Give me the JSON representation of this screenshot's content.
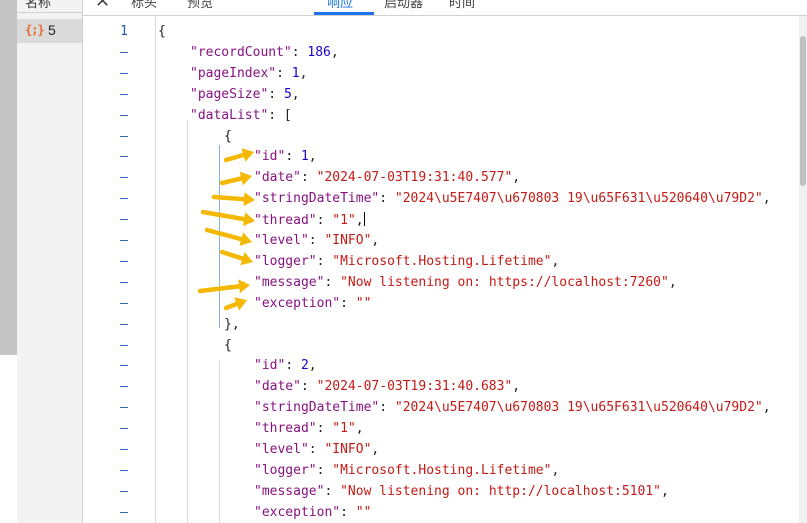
{
  "name_column": {
    "header": "名称",
    "request": {
      "icon": "{;}",
      "name": "5"
    }
  },
  "tabs": [
    {
      "label": "标头"
    },
    {
      "label": "预览"
    },
    {
      "label": "响应",
      "active": true
    },
    {
      "label": "启动器"
    },
    {
      "label": "时间"
    }
  ],
  "gutter": [
    "1",
    "–",
    "–",
    "–",
    "–",
    "–",
    "–",
    "–",
    "–",
    "–",
    "–",
    "–",
    "–",
    "–",
    "–",
    "–",
    "–",
    "–",
    "–",
    "–",
    "–",
    "–",
    "–",
    "–",
    "–"
  ],
  "lines": [
    {
      "indent": 0,
      "tokens": [
        [
          "pun",
          "{"
        ]
      ]
    },
    {
      "indent": 1,
      "tokens": [
        [
          "key",
          "\"recordCount\""
        ],
        [
          "pun",
          ": "
        ],
        [
          "num",
          "186"
        ],
        [
          "pun",
          ","
        ]
      ]
    },
    {
      "indent": 1,
      "tokens": [
        [
          "key",
          "\"pageIndex\""
        ],
        [
          "pun",
          ": "
        ],
        [
          "num",
          "1"
        ],
        [
          "pun",
          ","
        ]
      ]
    },
    {
      "indent": 1,
      "tokens": [
        [
          "key",
          "\"pageSize\""
        ],
        [
          "pun",
          ": "
        ],
        [
          "num",
          "5"
        ],
        [
          "pun",
          ","
        ]
      ]
    },
    {
      "indent": 1,
      "tokens": [
        [
          "key",
          "\"dataList\""
        ],
        [
          "pun",
          ": ["
        ]
      ]
    },
    {
      "indent": 2,
      "tokens": [
        [
          "pun",
          "{"
        ]
      ]
    },
    {
      "indent": 3,
      "tokens": [
        [
          "key",
          "\"id\""
        ],
        [
          "pun",
          ": "
        ],
        [
          "num",
          "1"
        ],
        [
          "pun",
          ","
        ]
      ]
    },
    {
      "indent": 3,
      "tokens": [
        [
          "key",
          "\"date\""
        ],
        [
          "pun",
          ": "
        ],
        [
          "str",
          "\"2024-07-03T19:31:40.577\""
        ],
        [
          "pun",
          ","
        ]
      ]
    },
    {
      "indent": 3,
      "tokens": [
        [
          "key",
          "\"stringDateTime\""
        ],
        [
          "pun",
          ": "
        ],
        [
          "str",
          "\"2024\\u5E7407\\u670803 19\\u65F631\\u520640\\u79D2\""
        ],
        [
          "pun",
          ","
        ]
      ]
    },
    {
      "indent": 3,
      "tokens": [
        [
          "key",
          "\"thread\""
        ],
        [
          "pun",
          ": "
        ],
        [
          "str",
          "\"1\""
        ],
        [
          "pun",
          ","
        ]
      ],
      "caret": true
    },
    {
      "indent": 3,
      "tokens": [
        [
          "key",
          "\"level\""
        ],
        [
          "pun",
          ": "
        ],
        [
          "str",
          "\"INFO\""
        ],
        [
          "pun",
          ","
        ]
      ]
    },
    {
      "indent": 3,
      "tokens": [
        [
          "key",
          "\"logger\""
        ],
        [
          "pun",
          ": "
        ],
        [
          "str",
          "\"Microsoft.Hosting.Lifetime\""
        ],
        [
          "pun",
          ","
        ]
      ]
    },
    {
      "indent": 3,
      "tokens": [
        [
          "key",
          "\"message\""
        ],
        [
          "pun",
          ": "
        ],
        [
          "str",
          "\"Now listening on: https://localhost:7260\""
        ],
        [
          "pun",
          ","
        ]
      ]
    },
    {
      "indent": 3,
      "tokens": [
        [
          "key",
          "\"exception\""
        ],
        [
          "pun",
          ": "
        ],
        [
          "str",
          "\"\""
        ]
      ]
    },
    {
      "indent": 2,
      "tokens": [
        [
          "pun",
          "},"
        ]
      ]
    },
    {
      "indent": 2,
      "tokens": [
        [
          "pun",
          "{"
        ]
      ]
    },
    {
      "indent": 3,
      "tokens": [
        [
          "key",
          "\"id\""
        ],
        [
          "pun",
          ": "
        ],
        [
          "num",
          "2"
        ],
        [
          "pun",
          ","
        ]
      ]
    },
    {
      "indent": 3,
      "tokens": [
        [
          "key",
          "\"date\""
        ],
        [
          "pun",
          ": "
        ],
        [
          "str",
          "\"2024-07-03T19:31:40.683\""
        ],
        [
          "pun",
          ","
        ]
      ]
    },
    {
      "indent": 3,
      "tokens": [
        [
          "key",
          "\"stringDateTime\""
        ],
        [
          "pun",
          ": "
        ],
        [
          "str",
          "\"2024\\u5E7407\\u670803 19\\u65F631\\u520640\\u79D2\""
        ],
        [
          "pun",
          ","
        ]
      ]
    },
    {
      "indent": 3,
      "tokens": [
        [
          "key",
          "\"thread\""
        ],
        [
          "pun",
          ": "
        ],
        [
          "str",
          "\"1\""
        ],
        [
          "pun",
          ","
        ]
      ]
    },
    {
      "indent": 3,
      "tokens": [
        [
          "key",
          "\"level\""
        ],
        [
          "pun",
          ": "
        ],
        [
          "str",
          "\"INFO\""
        ],
        [
          "pun",
          ","
        ]
      ]
    },
    {
      "indent": 3,
      "tokens": [
        [
          "key",
          "\"logger\""
        ],
        [
          "pun",
          ": "
        ],
        [
          "str",
          "\"Microsoft.Hosting.Lifetime\""
        ],
        [
          "pun",
          ","
        ]
      ]
    },
    {
      "indent": 3,
      "tokens": [
        [
          "key",
          "\"message\""
        ],
        [
          "pun",
          ": "
        ],
        [
          "str",
          "\"Now listening on: http://localhost:5101\""
        ],
        [
          "pun",
          ","
        ]
      ]
    },
    {
      "indent": 3,
      "tokens": [
        [
          "key",
          "\"exception\""
        ],
        [
          "pun",
          ": "
        ],
        [
          "str",
          "\"\""
        ]
      ]
    },
    {
      "indent": 3,
      "tokens": []
    }
  ],
  "colors": {
    "key": "#881280",
    "string": "#c41a16",
    "number": "#1c00cf",
    "accent": "#1a73e8",
    "annotation_arrow": "#f5b800"
  },
  "annotations": {
    "arrow_icon": "yellow-arrow-icon",
    "arrow_count": 8
  }
}
